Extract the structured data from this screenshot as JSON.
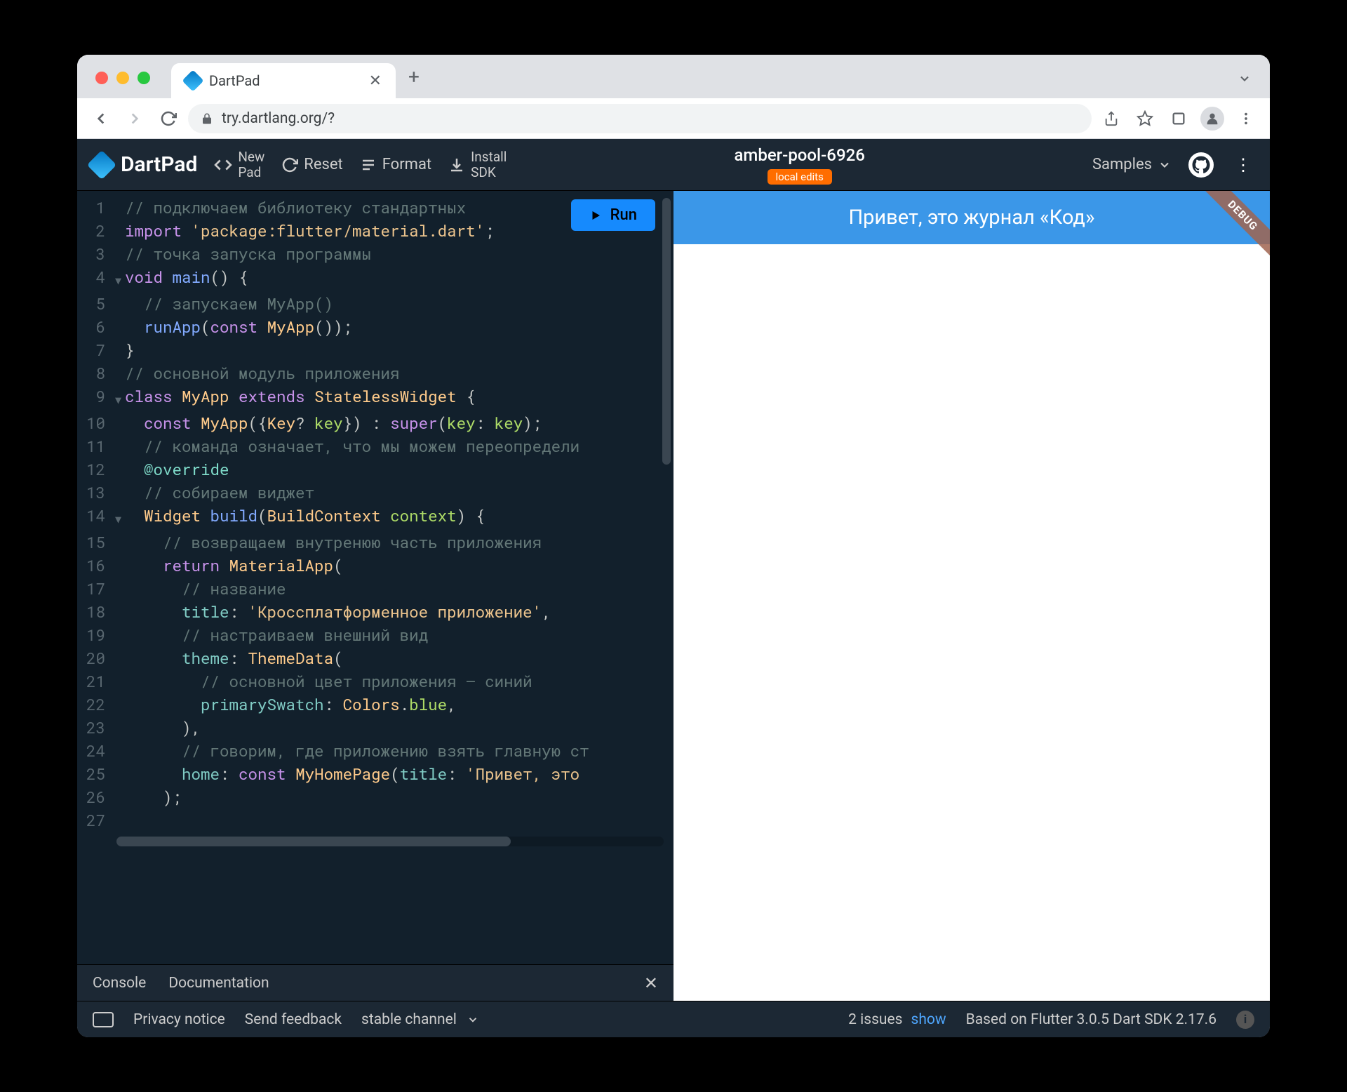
{
  "browser": {
    "tab_title": "DartPad",
    "url": "try.dartlang.org/?"
  },
  "toolbar": {
    "logo": "DartPad",
    "new_pad": "New\nPad",
    "reset": "Reset",
    "format": "Format",
    "install_sdk": "Install\nSDK",
    "project_name": "amber-pool-6926",
    "local_edits": "local edits",
    "samples": "Samples",
    "run": "Run"
  },
  "code": {
    "lines": [
      {
        "n": 1,
        "fold": "",
        "tokens": [
          [
            "// подключаем библиотеку стандартных ",
            "com"
          ]
        ]
      },
      {
        "n": 2,
        "fold": "",
        "tokens": [
          [
            "import ",
            "kw"
          ],
          [
            "'package:flutter/material.dart'",
            "str"
          ],
          [
            ";",
            "pun"
          ]
        ]
      },
      {
        "n": 3,
        "fold": "",
        "tokens": [
          [
            "// точка запуска программы",
            "com"
          ]
        ]
      },
      {
        "n": 4,
        "fold": "▼",
        "tokens": [
          [
            "void ",
            "kw"
          ],
          [
            "main",
            "fn"
          ],
          [
            "() {",
            "pun"
          ]
        ]
      },
      {
        "n": 5,
        "fold": "",
        "tokens": [
          [
            "  ",
            "pun"
          ],
          [
            "// запускаем MyApp()",
            "com"
          ]
        ]
      },
      {
        "n": 6,
        "fold": "",
        "tokens": [
          [
            "  ",
            "pun"
          ],
          [
            "runApp",
            "fn"
          ],
          [
            "(",
            "pun"
          ],
          [
            "const ",
            "kw"
          ],
          [
            "MyApp",
            "typ"
          ],
          [
            "());",
            "pun"
          ]
        ]
      },
      {
        "n": 7,
        "fold": "",
        "tokens": [
          [
            "}",
            "pun"
          ]
        ]
      },
      {
        "n": 8,
        "fold": "",
        "tokens": [
          [
            "// основной модуль приложения",
            "com"
          ]
        ]
      },
      {
        "n": 9,
        "fold": "▼",
        "tokens": [
          [
            "class ",
            "kw"
          ],
          [
            "MyApp ",
            "typ"
          ],
          [
            "extends ",
            "kw"
          ],
          [
            "StatelessWidget ",
            "typ"
          ],
          [
            "{",
            "pun"
          ]
        ]
      },
      {
        "n": 10,
        "fold": "",
        "tokens": [
          [
            "  ",
            "pun"
          ],
          [
            "const ",
            "kw"
          ],
          [
            "MyApp",
            "typ"
          ],
          [
            "({",
            "pun"
          ],
          [
            "Key",
            "typ"
          ],
          [
            "? ",
            "pun"
          ],
          [
            "key",
            "var"
          ],
          [
            "}) : ",
            "pun"
          ],
          [
            "super",
            "kw"
          ],
          [
            "(",
            "pun"
          ],
          [
            "key",
            "var"
          ],
          [
            ": ",
            "pun"
          ],
          [
            "key",
            "var"
          ],
          [
            ");",
            "pun"
          ]
        ]
      },
      {
        "n": 11,
        "fold": "",
        "tokens": [
          [
            "  ",
            "pun"
          ],
          [
            "// команда означает, что мы можем переопредели",
            "com"
          ]
        ]
      },
      {
        "n": 12,
        "fold": "",
        "tokens": [
          [
            "  ",
            "pun"
          ],
          [
            "@override",
            "id"
          ]
        ]
      },
      {
        "n": 13,
        "fold": "",
        "tokens": [
          [
            "  ",
            "pun"
          ],
          [
            "// собираем виджет",
            "com"
          ]
        ]
      },
      {
        "n": 14,
        "fold": "▼",
        "tokens": [
          [
            "  ",
            "pun"
          ],
          [
            "Widget ",
            "typ"
          ],
          [
            "build",
            "fn"
          ],
          [
            "(",
            "pun"
          ],
          [
            "BuildContext ",
            "typ"
          ],
          [
            "context",
            "var"
          ],
          [
            ") {",
            "pun"
          ]
        ]
      },
      {
        "n": 15,
        "fold": "",
        "tokens": [
          [
            "    ",
            "pun"
          ],
          [
            "// возвращаем внутренюю часть приложения",
            "com"
          ]
        ]
      },
      {
        "n": 16,
        "fold": "",
        "tokens": [
          [
            "    ",
            "pun"
          ],
          [
            "return ",
            "kw"
          ],
          [
            "MaterialApp",
            "typ"
          ],
          [
            "(",
            "pun"
          ]
        ]
      },
      {
        "n": 17,
        "fold": "",
        "tokens": [
          [
            "      ",
            "pun"
          ],
          [
            "// название",
            "com"
          ]
        ]
      },
      {
        "n": 18,
        "fold": "",
        "tokens": [
          [
            "      ",
            "pun"
          ],
          [
            "title",
            "prop"
          ],
          [
            ": ",
            "pun"
          ],
          [
            "'Кроссплатформенное приложение'",
            "str"
          ],
          [
            ",",
            "pun"
          ]
        ]
      },
      {
        "n": 19,
        "fold": "",
        "tokens": [
          [
            "      ",
            "pun"
          ],
          [
            "// настраиваем внешний вид",
            "com"
          ]
        ]
      },
      {
        "n": 20,
        "fold": "",
        "tokens": [
          [
            "      ",
            "pun"
          ],
          [
            "theme",
            "prop"
          ],
          [
            ": ",
            "pun"
          ],
          [
            "ThemeData",
            "typ"
          ],
          [
            "(",
            "pun"
          ]
        ]
      },
      {
        "n": 21,
        "fold": "",
        "tokens": [
          [
            "        ",
            "pun"
          ],
          [
            "// основной цвет приложения — синий",
            "com"
          ]
        ]
      },
      {
        "n": 22,
        "fold": "",
        "tokens": [
          [
            "        ",
            "pun"
          ],
          [
            "primarySwatch",
            "prop"
          ],
          [
            ": ",
            "pun"
          ],
          [
            "Colors",
            "typ"
          ],
          [
            ".",
            "pun"
          ],
          [
            "blue",
            "var"
          ],
          [
            ",",
            "pun"
          ]
        ]
      },
      {
        "n": 23,
        "fold": "",
        "tokens": [
          [
            "      ),",
            "pun"
          ]
        ]
      },
      {
        "n": 24,
        "fold": "",
        "tokens": [
          [
            "      ",
            "pun"
          ],
          [
            "// говорим, где приложению взять главную ст",
            "com"
          ]
        ]
      },
      {
        "n": 25,
        "fold": "",
        "tokens": [
          [
            "      ",
            "pun"
          ],
          [
            "home",
            "prop"
          ],
          [
            ": ",
            "pun"
          ],
          [
            "const ",
            "kw"
          ],
          [
            "MyHomePage",
            "typ"
          ],
          [
            "(",
            "pun"
          ],
          [
            "title",
            "prop"
          ],
          [
            ": ",
            "pun"
          ],
          [
            "'Привет, это ",
            "str"
          ]
        ]
      },
      {
        "n": 26,
        "fold": "",
        "tokens": [
          [
            "    );",
            "pun"
          ]
        ]
      },
      {
        "n": 27,
        "fold": "",
        "tokens": [
          [
            "",
            "pun"
          ]
        ]
      }
    ]
  },
  "console": {
    "tab_console": "Console",
    "tab_docs": "Documentation"
  },
  "output": {
    "appbar_title": "Привет, это журнал «Код»",
    "debug": "DEBUG"
  },
  "footer": {
    "privacy": "Privacy notice",
    "feedback": "Send feedback",
    "channel": "stable channel",
    "issues": "2 issues",
    "show": "show",
    "based_on": "Based on Flutter 3.0.5 Dart SDK 2.17.6"
  }
}
